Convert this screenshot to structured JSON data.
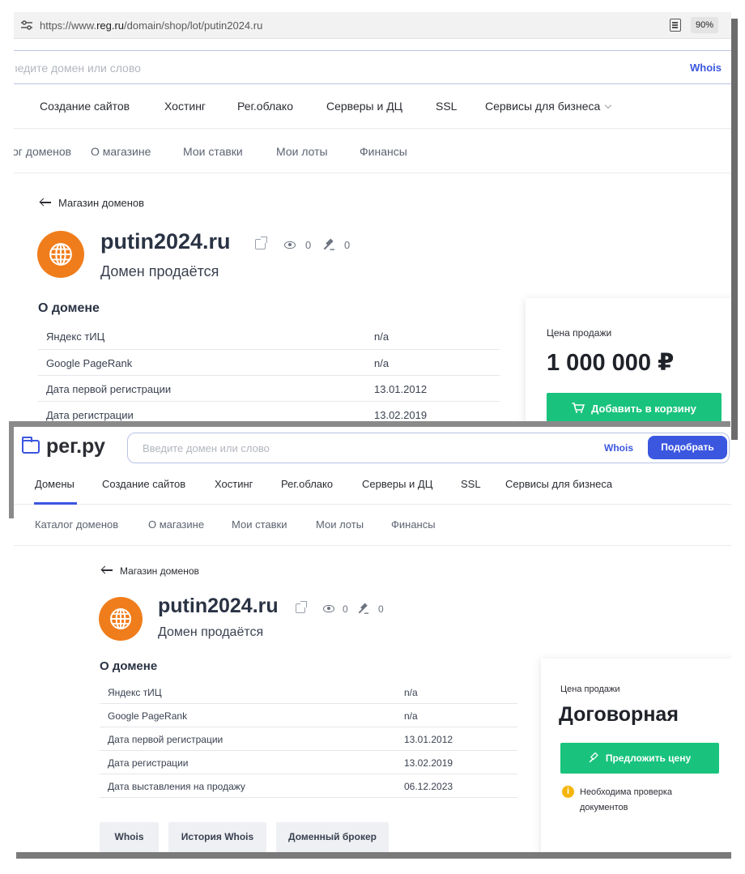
{
  "browser": {
    "url_prefix": "https://www.",
    "url_host": "reg.ru",
    "url_path": "/domain/shop/lot/putin2024.ru",
    "zoom": "90%"
  },
  "top": {
    "search_placeholder": "Введите домен или слово",
    "whois": "Whois",
    "nav": [
      "Создание сайтов",
      "Хостинг",
      "Рег.облако",
      "Серверы и ДЦ",
      "SSL",
      "Сервисы для бизнеса"
    ],
    "subnav": [
      "Каталог доменов",
      "О магазине",
      "Мои ставки",
      "Мои лоты",
      "Финансы"
    ],
    "back": "Магазин доменов",
    "domain": "putin2024.ru",
    "views": "0",
    "bids": "0",
    "status": "Домен продаётся",
    "about_title": "О домене",
    "rows": [
      {
        "k": "Яндекс тИЦ",
        "v": "n/a"
      },
      {
        "k": "Google PageRank",
        "v": "n/a"
      },
      {
        "k": "Дата первой регистрации",
        "v": "13.01.2012"
      },
      {
        "k": "Дата регистрации",
        "v": "13.02.2019"
      }
    ],
    "price_label": "Цена продажи",
    "price": "1 000 000 ₽",
    "cart_button": "Добавить в корзину"
  },
  "bottom": {
    "logo": "рег.ру",
    "search_placeholder": "Введите домен или слово",
    "whois": "Whois",
    "pick_button": "Подобрать",
    "nav": [
      "Домены",
      "Создание сайтов",
      "Хостинг",
      "Рег.облако",
      "Серверы и ДЦ",
      "SSL",
      "Сервисы для бизнеса"
    ],
    "subnav": [
      "Каталог доменов",
      "О магазине",
      "Мои ставки",
      "Мои лоты",
      "Финансы"
    ],
    "back": "Магазин доменов",
    "domain": "putin2024.ru",
    "views": "0",
    "bids": "0",
    "status": "Домен продаётся",
    "about_title": "О домене",
    "rows": [
      {
        "k": "Яндекс тИЦ",
        "v": "n/a"
      },
      {
        "k": "Google PageRank",
        "v": "n/a"
      },
      {
        "k": "Дата первой регистрации",
        "v": "13.01.2012"
      },
      {
        "k": "Дата регистрации",
        "v": "13.02.2019"
      },
      {
        "k": "Дата выставления на продажу",
        "v": "06.12.2023"
      }
    ],
    "buttons": [
      "Whois",
      "История Whois",
      "Доменный брокер"
    ],
    "price_label": "Цена продажи",
    "price": "Договорная",
    "offer_button": "Предложить цену",
    "note": "Необходима проверка документов"
  },
  "colors": {
    "accent": "#3b57e0",
    "green": "#19c37d",
    "globe": "#f07d1b",
    "warning": "#f5b50a"
  }
}
